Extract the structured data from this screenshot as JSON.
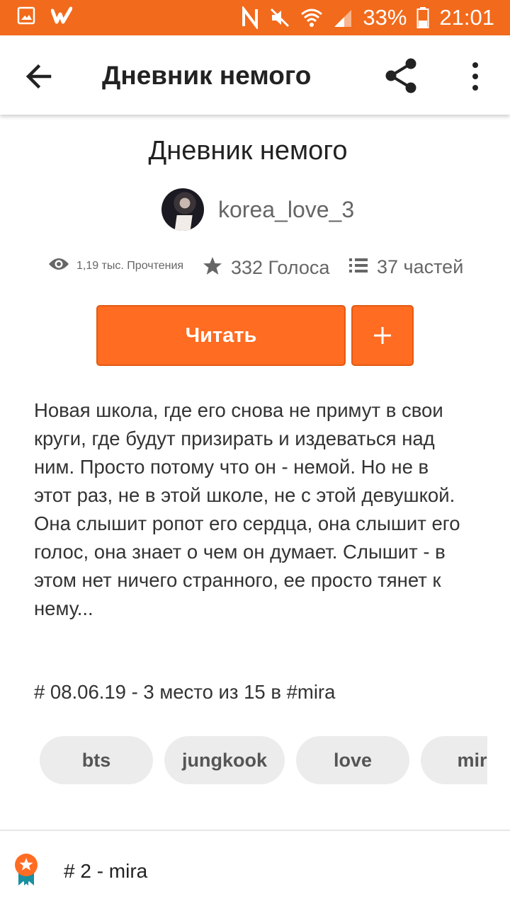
{
  "status_bar": {
    "battery": "33%",
    "time": "21:01",
    "icons": [
      "image-icon",
      "wattpad-icon",
      "nfc-icon",
      "mute-icon",
      "wifi-icon",
      "signal-icon",
      "battery-icon"
    ]
  },
  "app_bar": {
    "title": "Дневник немого",
    "icons": [
      "back-arrow-icon",
      "share-icon",
      "more-vert-icon"
    ]
  },
  "story": {
    "title": "Дневник немого",
    "author": "korea_love_3",
    "reads": "1,19 тыс. Прочтения",
    "votes": "332 Голоса",
    "parts": "37 частей",
    "read_button": "Читать",
    "add_button": "+",
    "description_lines": [
      "Новая школа, где его снова не примут в свои",
      "круги, где будут призирать и издеваться над",
      "ним. Просто потому что он - немой. Но не в",
      "этот раз, не в этой школе, не с этой девушкой.",
      "Она слышит ропот его сердца, она слышит его",
      "голос, она знает о чем он думает. Слышит - в",
      "этом нет ничего странного, ее просто тянет к",
      "нему..."
    ],
    "ranking_note": "# 08.06.19 - 3 место из 15 в  #mira"
  },
  "tags": [
    "bts",
    "jungkook",
    "love",
    "mira"
  ],
  "ranking": {
    "label": "# 2 - mira"
  },
  "colors": {
    "accent": "#ff6c22",
    "status_bar": "#f26a1b",
    "badge_ribbon": "#1a8fa0"
  }
}
